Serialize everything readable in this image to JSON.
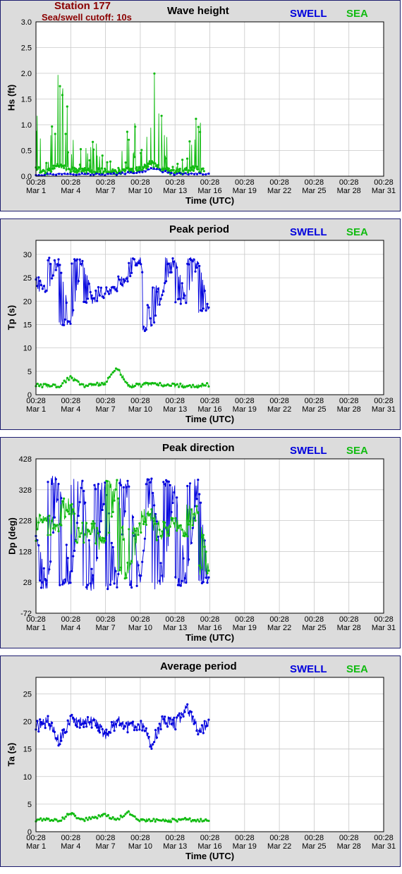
{
  "station": {
    "name": "Station 177",
    "cutoff": "Sea/swell cutoff: 10s"
  },
  "legend": {
    "swell": "SWELL",
    "sea": "SEA",
    "swell_color": "#0000dd",
    "sea_color": "#11bb11"
  },
  "x_ticks": [
    [
      "00:28",
      "Mar 1"
    ],
    [
      "00:28",
      "Mar 4"
    ],
    [
      "00:28",
      "Mar 7"
    ],
    [
      "00:28",
      "Mar 10"
    ],
    [
      "00:28",
      "Mar 13"
    ],
    [
      "00:28",
      "Mar 16"
    ],
    [
      "00:28",
      "Mar 19"
    ],
    [
      "00:28",
      "Mar 22"
    ],
    [
      "00:28",
      "Mar 25"
    ],
    [
      "00:28",
      "Mar 28"
    ],
    [
      "00:28",
      "Mar 31"
    ]
  ],
  "chart_data": [
    {
      "type": "line",
      "title": "Wave height",
      "xlabel": "Time (UTC)",
      "ylabel": "Hs (ft)",
      "xlim": [
        "Mar 1 00:28",
        "Mar 31 00:28"
      ],
      "ylim": [
        0,
        3.0
      ],
      "yticks": [
        "0.0",
        "0.5",
        "1.0",
        "1.5",
        "2.0",
        "2.5",
        "3.0"
      ],
      "grid": true,
      "legend_placement": "top-right",
      "series": [
        {
          "name": "SWELL",
          "color": "#0000dd",
          "x": [
            "Mar 1",
            "Mar 4",
            "Mar 7",
            "Mar 10",
            "Mar 11",
            "Mar 13",
            "Mar 15.9"
          ],
          "y": [
            0.03,
            0.05,
            0.03,
            0.08,
            0.15,
            0.04,
            0.05
          ]
        },
        {
          "name": "SEA",
          "color": "#11bb11",
          "x": [
            "Mar 1",
            "Mar 2",
            "Mar 2.8",
            "Mar 3.5",
            "Mar 4.5",
            "Mar 6",
            "Mar 8",
            "Mar 9",
            "Mar 10",
            "Mar 10.5",
            "Mar 11",
            "Mar 12",
            "Mar 13",
            "Mar 14",
            "Mar 14.5",
            "Mar 15.5"
          ],
          "y": [
            1.05,
            0.15,
            1.78,
            1.2,
            0.4,
            0.55,
            0.15,
            0.8,
            0.9,
            1.8,
            2.35,
            0.8,
            0.1,
            0.7,
            1.28,
            0.6
          ]
        }
      ]
    },
    {
      "type": "line",
      "title": "Peak period",
      "xlabel": "Time (UTC)",
      "ylabel": "Tp (s)",
      "xlim": [
        "Mar 1 00:28",
        "Mar 31 00:28"
      ],
      "ylim": [
        0,
        33
      ],
      "yticks": [
        "0",
        "5",
        "10",
        "15",
        "20",
        "25",
        "30"
      ],
      "grid": true,
      "legend_placement": "top-right",
      "series": [
        {
          "name": "SWELL",
          "color": "#0000dd",
          "x": [
            "Mar 1",
            "Mar 2",
            "Mar 3",
            "Mar 4",
            "Mar 5",
            "Mar 6",
            "Mar 8",
            "Mar 9",
            "Mar 10",
            "Mar 11",
            "Mar 12",
            "Mar 13",
            "Mar 14",
            "Mar 15",
            "Mar 15.9"
          ],
          "y": [
            25,
            22.7,
            28.6,
            15.4,
            28.6,
            20.1,
            22.7,
            25,
            28.6,
            14.3,
            22.7,
            28.6,
            20.1,
            28.6,
            18.2
          ]
        },
        {
          "name": "SEA",
          "color": "#11bb11",
          "x": [
            "Mar 1",
            "Mar 3",
            "Mar 4",
            "Mar 5",
            "Mar 7",
            "Mar 8",
            "Mar 9",
            "Mar 11",
            "Mar 13",
            "Mar 15",
            "Mar 15.9"
          ],
          "y": [
            2.0,
            1.9,
            3.8,
            1.9,
            2.5,
            5.8,
            1.8,
            2.3,
            2.0,
            1.9,
            2.1
          ]
        }
      ]
    },
    {
      "type": "line",
      "title": "Peak direction",
      "xlabel": "Time (UTC)",
      "ylabel": "Dp (deg)",
      "xlim": [
        "Mar 1 00:28",
        "Mar 31 00:28"
      ],
      "ylim": [
        -72,
        428
      ],
      "yticks": [
        "-72",
        "28",
        "128",
        "228",
        "328",
        "428"
      ],
      "grid": true,
      "legend_placement": "top-right",
      "series": [
        {
          "name": "SWELL",
          "color": "#0000dd",
          "x": [
            "Mar 1",
            "Mar 2",
            "Mar 3",
            "Mar 4",
            "Mar 5",
            "Mar 6",
            "Mar 7",
            "Mar 8",
            "Mar 9",
            "Mar 10",
            "Mar 11",
            "Mar 12",
            "Mar 13",
            "Mar 14",
            "Mar 15",
            "Mar 15.9"
          ],
          "y": [
            180,
            20,
            360,
            30,
            355,
            15,
            340,
            20,
            350,
            25,
            360,
            20,
            345,
            30,
            350,
            40
          ]
        },
        {
          "name": "SEA",
          "color": "#11bb11",
          "x": [
            "Mar 1",
            "Mar 2",
            "Mar 3",
            "Mar 4",
            "Mar 5",
            "Mar 6",
            "Mar 7",
            "Mar 8",
            "Mar 9",
            "Mar 10",
            "Mar 11",
            "Mar 12",
            "Mar 13",
            "Mar 14",
            "Mar 15",
            "Mar 15.9"
          ],
          "y": [
            180,
            240,
            200,
            280,
            170,
            210,
            150,
            340,
            60,
            200,
            250,
            180,
            220,
            190,
            260,
            70
          ]
        }
      ]
    },
    {
      "type": "line",
      "title": "Average period",
      "xlabel": "Time (UTC)",
      "ylabel": "Ta (s)",
      "xlim": [
        "Mar 1 00:28",
        "Mar 31 00:28"
      ],
      "ylim": [
        0,
        28
      ],
      "yticks": [
        "0",
        "5",
        "10",
        "15",
        "20",
        "25"
      ],
      "grid": true,
      "legend_placement": "top-right",
      "series": [
        {
          "name": "SWELL",
          "color": "#0000dd",
          "x": [
            "Mar 1",
            "Mar 2",
            "Mar 3",
            "Mar 4",
            "Mar 5",
            "Mar 6",
            "Mar 7",
            "Mar 8",
            "Mar 9",
            "Mar 10",
            "Mar 11",
            "Mar 12",
            "Mar 13",
            "Mar 14",
            "Mar 15",
            "Mar 15.9"
          ],
          "y": [
            19,
            20,
            16.5,
            20.5,
            19.5,
            20,
            17.5,
            20,
            19,
            19.5,
            16,
            20.5,
            19.5,
            22.5,
            18.5,
            19.5
          ]
        },
        {
          "name": "SEA",
          "color": "#11bb11",
          "x": [
            "Mar 1",
            "Mar 2",
            "Mar 3",
            "Mar 4",
            "Mar 5",
            "Mar 6",
            "Mar 7",
            "Mar 8",
            "Mar 9",
            "Mar 10",
            "Mar 11",
            "Mar 12",
            "Mar 13",
            "Mar 14",
            "Mar 15",
            "Mar 15.9"
          ],
          "y": [
            2.0,
            2.3,
            2.0,
            3.3,
            2.1,
            2.6,
            3.0,
            2.2,
            3.6,
            2.0,
            2.2,
            2.0,
            2.1,
            2.3,
            2.0,
            2.2
          ]
        }
      ]
    }
  ]
}
